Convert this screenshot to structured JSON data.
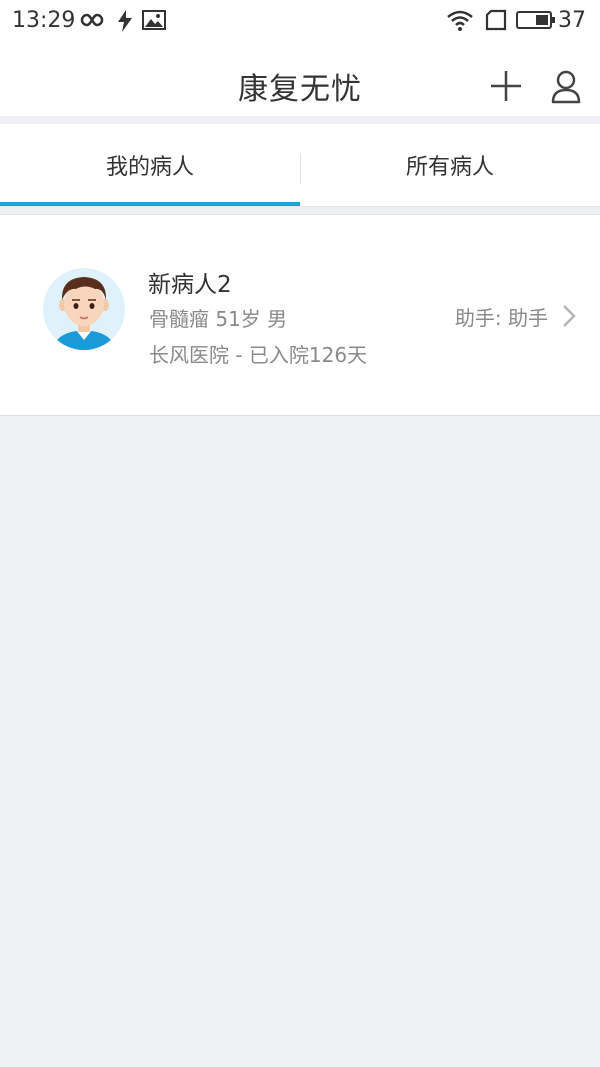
{
  "status_bar": {
    "time": "13:29",
    "battery": "37",
    "icons": [
      "infinity-icon",
      "flash-icon",
      "image-icon",
      "wifi-icon",
      "sim-icon",
      "battery-icon"
    ]
  },
  "header": {
    "title": "康复无忧",
    "icons": [
      "add-icon",
      "user-icon"
    ]
  },
  "tabs": [
    {
      "label": "我的病人",
      "active": true
    },
    {
      "label": "所有病人",
      "active": false
    }
  ],
  "patients": [
    {
      "name": "新病人2",
      "info": "骨髓瘤 51岁 男",
      "hospital": "长风医院 - 已入院126天",
      "assistant": "助手: 助手"
    }
  ],
  "colors": {
    "accent": "#1aa5d6",
    "background": "#eef0f3",
    "text": "#333333",
    "secondary_text": "#8a8a8a"
  }
}
